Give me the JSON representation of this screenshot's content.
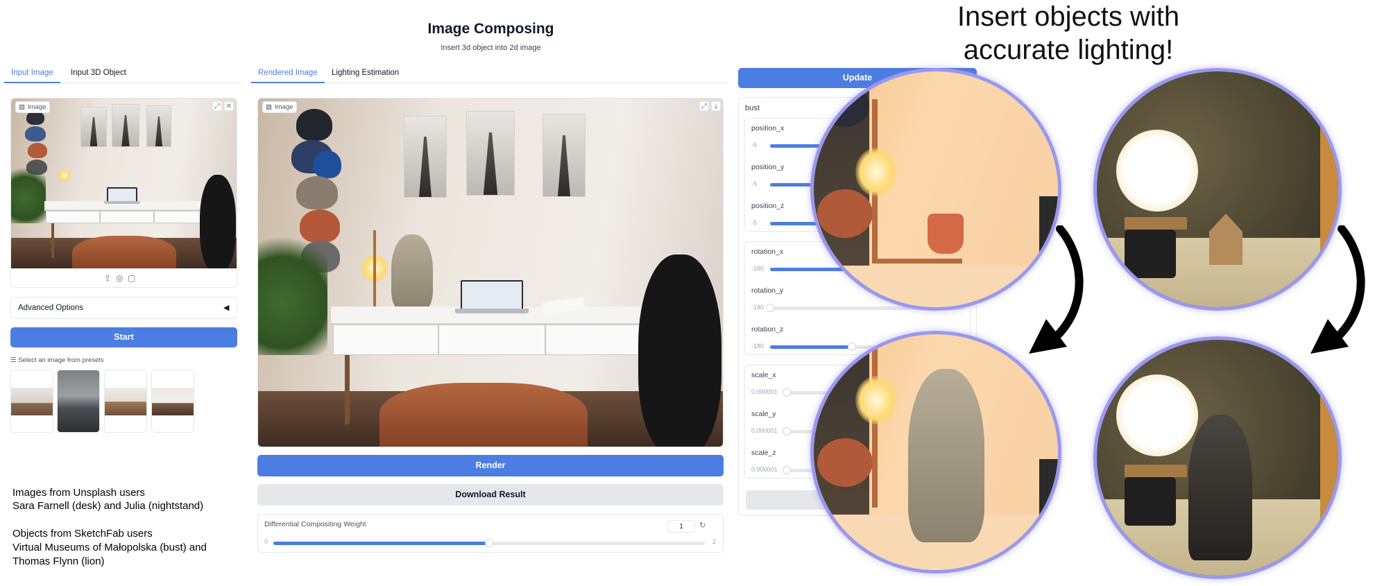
{
  "header": {
    "title": "Image Composing",
    "subtitle": "Insert 3d object into 2d image"
  },
  "left_panel": {
    "tabs": [
      {
        "label": "Input Image",
        "active": true
      },
      {
        "label": "Input 3D Object",
        "active": false
      }
    ],
    "image_label": "Image",
    "advanced_options_label": "Advanced Options",
    "start_label": "Start",
    "presets_label": "Select an image from presets"
  },
  "center_panel": {
    "tabs": [
      {
        "label": "Rendered Image",
        "active": true
      },
      {
        "label": "Lighting Estimation",
        "active": false
      }
    ],
    "image_label": "Image",
    "render_label": "Render",
    "download_label": "Download Result",
    "weight": {
      "label": "Differential Compositing Weight",
      "value": "1",
      "min": "0",
      "max": "2",
      "fraction": 0.5
    }
  },
  "right_panel": {
    "update_label": "Update",
    "object_name": "bust",
    "groups": [
      {
        "sliders": [
          {
            "label": "position_x",
            "min": "-5",
            "fraction": 0.55
          },
          {
            "label": "position_y",
            "min": "-5",
            "fraction": 0.55
          },
          {
            "label": "position_z",
            "min": "-5",
            "fraction": 0.55
          }
        ]
      },
      {
        "sliders": [
          {
            "label": "rotation_x",
            "min": "-180",
            "fraction": 0.5
          },
          {
            "label": "rotation_y",
            "min": "-180",
            "fraction": 0.0
          },
          {
            "label": "rotation_z",
            "min": "-180",
            "fraction": 0.42
          }
        ]
      },
      {
        "sliders": [
          {
            "label": "scale_x",
            "min": "0.000001",
            "fraction": 0.0
          },
          {
            "label": "scale_y",
            "min": "0.000001",
            "fraction": 0.0
          },
          {
            "label": "scale_z",
            "min": "0.000001",
            "fraction": 0.0
          }
        ]
      }
    ]
  },
  "promo": {
    "headline_line1": "Insert objects with",
    "headline_line2": "accurate lighting!"
  },
  "credits": {
    "line1": "Images from Unsplash users",
    "line2": "Sara Farnell (desk) and Julia (nightstand)",
    "line3": "Objects from SketchFab users",
    "line4": "Virtual Museums of Małopolska (bust) and",
    "line5": "Thomas Flynn (lion)"
  },
  "colors": {
    "accent": "#4b7de2",
    "circle_border": "#9a98ee"
  },
  "icons": [
    "image-icon",
    "fullscreen-icon",
    "close-icon",
    "download-icon",
    "upload-icon",
    "webcam-icon",
    "clipboard-icon",
    "collapse-arrow-icon",
    "reset-icon",
    "list-icon"
  ]
}
